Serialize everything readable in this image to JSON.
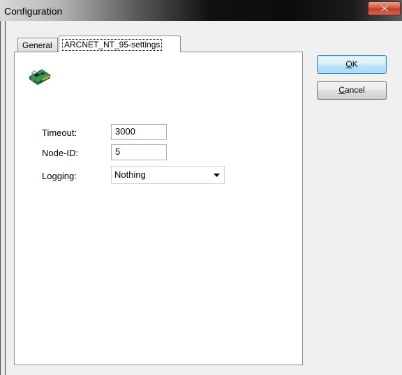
{
  "window": {
    "title": "Configuration"
  },
  "tabs": [
    {
      "label": "General",
      "active": false
    },
    {
      "label": "ARCNET_NT_95-settings",
      "active": true
    }
  ],
  "form": {
    "timeout": {
      "label": "Timeout:",
      "value": "3000"
    },
    "node_id": {
      "label": "Node-ID:",
      "value": "5"
    },
    "logging": {
      "label": "Logging:",
      "selected": "Nothing"
    }
  },
  "buttons": {
    "ok": {
      "mnemonic": "O",
      "rest": "K"
    },
    "cancel": {
      "mnemonic": "C",
      "rest": "ancel"
    }
  },
  "icons": {
    "device": "network-card-icon",
    "close": "close-icon",
    "dropdown": "chevron-down-icon"
  },
  "colors": {
    "close_button": "#c94a35",
    "ok_button_border": "#3c7fb1",
    "panel_border": "#898c95"
  }
}
